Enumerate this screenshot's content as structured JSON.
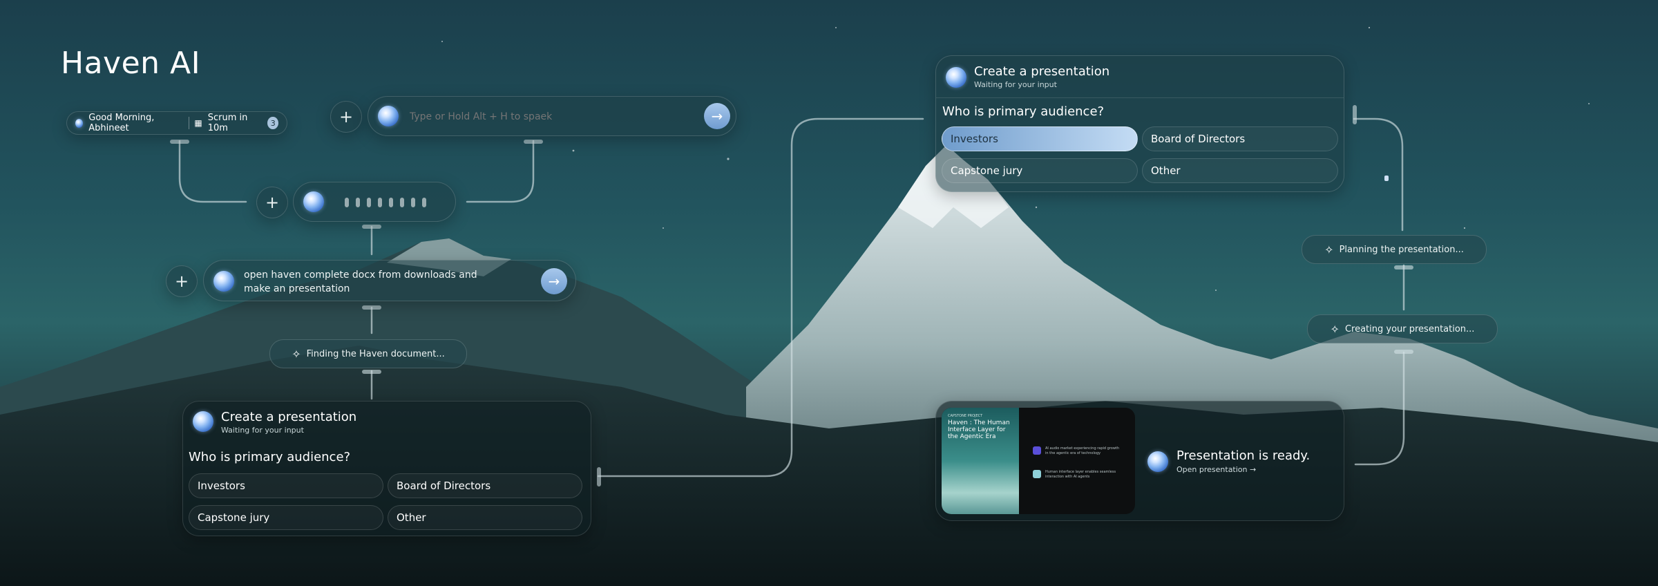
{
  "app_title": "Haven AI",
  "greeting_pill": {
    "greeting": "Good Morning, Abhineet",
    "meeting": "Scrum in 10m",
    "badge_count": "3"
  },
  "prompt_input": {
    "placeholder": "Type or Hold Alt + H to spaek"
  },
  "voice_input": {
    "state": "listening"
  },
  "command_input": {
    "text": "open haven complete docx from downloads and make an presentation"
  },
  "status_steps": {
    "finding": "Finding the Haven document...",
    "planning": "Planning the presentation...",
    "creating": "Creating your presentation..."
  },
  "prompt_card_left": {
    "title": "Create a presentation",
    "subtitle": "Waiting for your input",
    "question": "Who is primary audience?",
    "options": [
      "Investors",
      "Board of Directors",
      "Capstone jury",
      "Other"
    ]
  },
  "prompt_card_right": {
    "title": "Create a presentation",
    "subtitle": "Waiting for your input",
    "question": "Who is primary audience?",
    "options": [
      "Investors",
      "Board of Directors",
      "Capstone jury",
      "Other"
    ],
    "selected": "Investors"
  },
  "result_card": {
    "title": "Presentation is ready.",
    "link": "Open presentation →",
    "thumbnail": {
      "kicker": "CAPSTONE PROJECT",
      "slide_title": "Haven : The Human Interface Layer for the Agentic Era",
      "point_1": "AI audio market experiencing rapid growth in the agentic era of technology",
      "point_2": "Human interface layer enables seamless interaction with AI agents"
    }
  },
  "icons": {
    "plus": "plus-icon",
    "send": "arrow-right-icon",
    "calendar": "calendar-icon",
    "spark": "sparkle-icon",
    "orb": "haven-orb-icon"
  },
  "colors": {
    "accent": "#8fb6e0",
    "selected_option": "#a9c8ec"
  }
}
